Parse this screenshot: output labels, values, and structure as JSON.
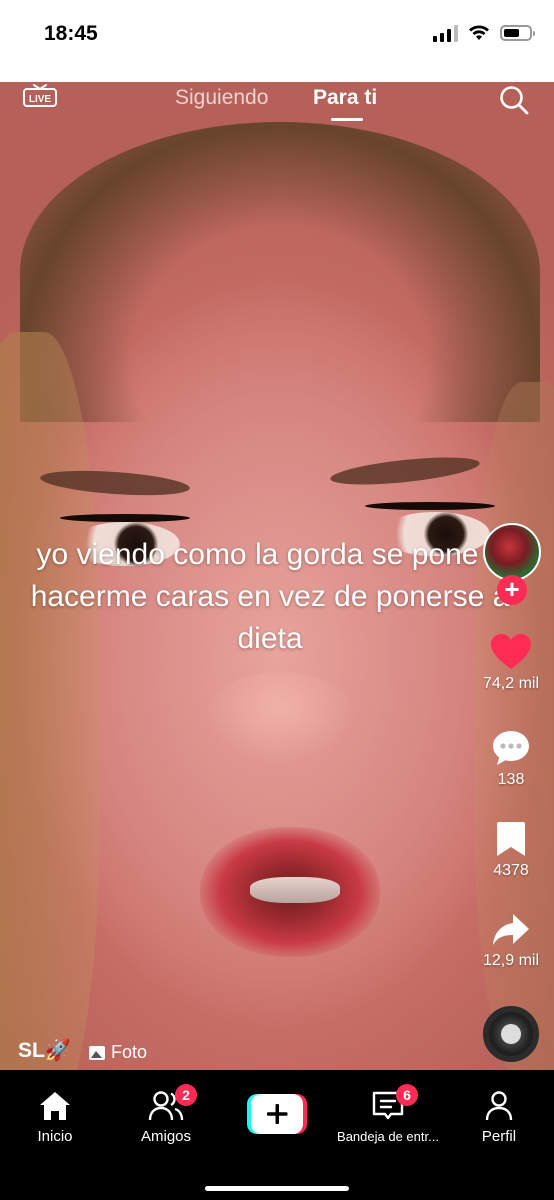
{
  "status_bar": {
    "time": "18:45",
    "battery_level": 0.55
  },
  "top_nav": {
    "live_label": "LIVE",
    "tabs": [
      {
        "label": "Siguiendo",
        "active": false
      },
      {
        "label": "Para ti",
        "active": true
      }
    ]
  },
  "video": {
    "caption": "yo viendo como la gorda se pone a hacerme caras en vez de ponerse a dieta",
    "author": "SL🚀",
    "media_type": "Foto"
  },
  "actions": {
    "likes": "74,2 mil",
    "comments": "138",
    "saves": "4378",
    "shares": "12,9 mil"
  },
  "bottom_nav": {
    "items": [
      {
        "label": "Inicio",
        "icon": "home-icon",
        "active": true
      },
      {
        "label": "Amigos",
        "icon": "friends-icon",
        "badge": "2"
      },
      {
        "label": "Bandeja de entr...",
        "icon": "inbox-icon",
        "badge": "6"
      },
      {
        "label": "Perfil",
        "icon": "profile-icon"
      }
    ]
  },
  "colors": {
    "accent": "#fe2c55",
    "like": "#fe2c55"
  }
}
